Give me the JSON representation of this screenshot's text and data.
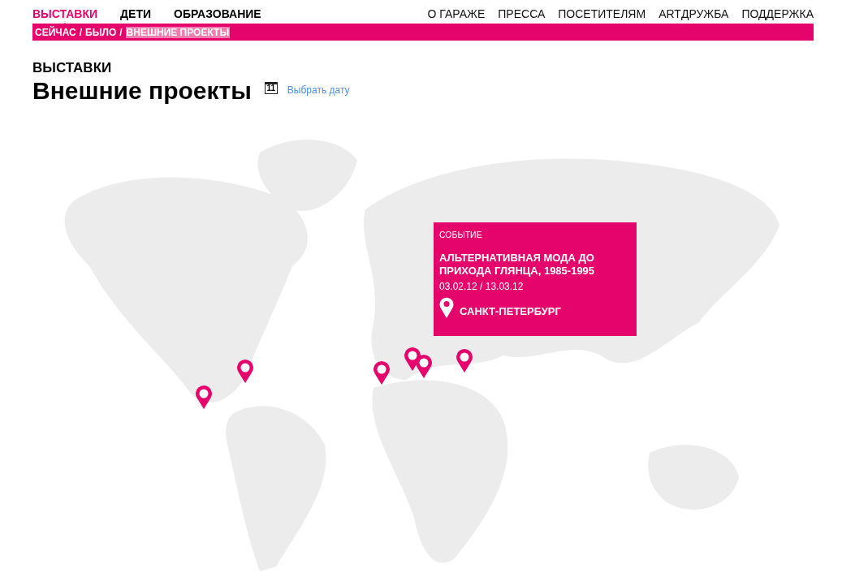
{
  "main_nav": [
    {
      "label": "ВЫСТАВКИ",
      "selected": true
    },
    {
      "label": "ДЕТИ",
      "selected": false
    },
    {
      "label": "ОБРАЗОВАНИЕ",
      "selected": false
    }
  ],
  "secondary_nav": [
    "О ГАРАЖЕ",
    "ПРЕССА",
    "ПОСЕТИТЕЛЯМ",
    "ARTДРУЖБА",
    "ПОДДЕРЖКА"
  ],
  "breadcrumb": [
    {
      "label": "СЕЙЧАС",
      "selected": false
    },
    {
      "label": "БЫЛО",
      "selected": false
    },
    {
      "label": "ВНЕШНИЕ ПРОЕКТЫ",
      "selected": true
    }
  ],
  "breadcrumb_separator": "/",
  "section": "ВЫСТАВКИ",
  "title": "Внешние проекты",
  "date_picker": {
    "icon_day": "11",
    "label": "Выбрать дату"
  },
  "popup": {
    "kind": "СОБЫТИЕ",
    "title": "АЛЬТЕРНАТИВНАЯ МОДА ДО ПРИХОДА ГЛЯНЦА, 1985-1995",
    "dates": "03.02.12 / 13.03.12",
    "city": "САНКТ-ПЕТЕРБУРГ"
  }
}
